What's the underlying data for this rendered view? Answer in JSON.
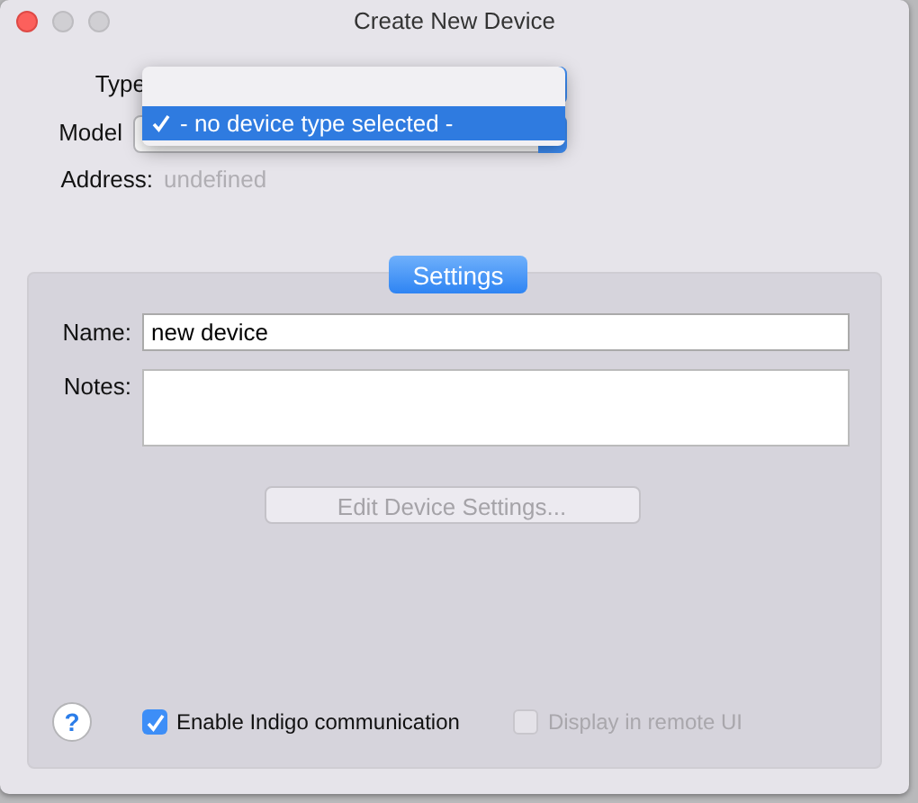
{
  "window": {
    "title": "Create New Device"
  },
  "popups": [
    {
      "label": "Type"
    },
    {
      "label": "Model"
    }
  ],
  "address": {
    "label": "Address:",
    "value": "undefined"
  },
  "popup_menu": {
    "items": [
      {
        "kind": "blank"
      },
      {
        "kind": "text",
        "label": "- no device type selected -",
        "selected": true,
        "checked": true
      }
    ]
  },
  "settings_tab": {
    "label": "Settings",
    "selected": true
  },
  "name_field": {
    "label": "Name:",
    "value": "new device"
  },
  "notes_field": {
    "label": "Notes:"
  },
  "edit_button": {
    "label": "Edit Device Settings...",
    "disabled": true
  },
  "help_button": {
    "label": "?"
  },
  "options": [
    {
      "label": "Enable Indigo communication",
      "checked": true,
      "disabled": false
    },
    {
      "label": "Display in remote UI",
      "checked": false,
      "disabled": true
    }
  ]
}
